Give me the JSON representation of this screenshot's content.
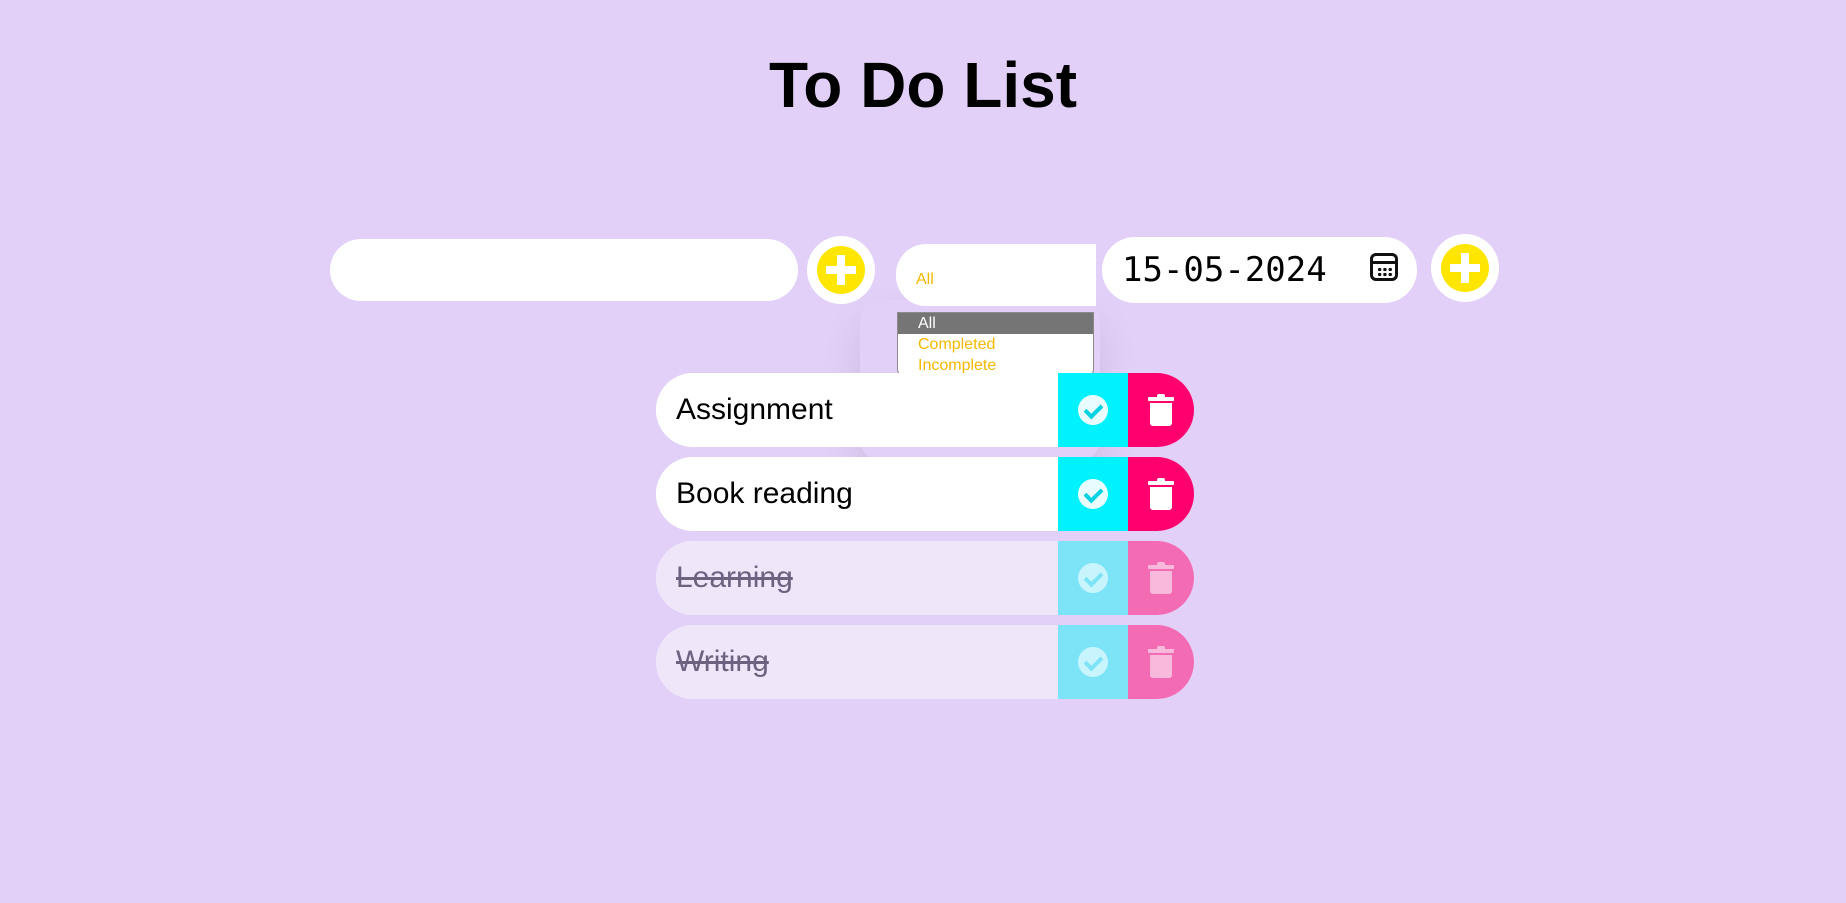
{
  "header": {
    "title": "To Do List"
  },
  "form": {
    "todo_input_value": "",
    "todo_input_placeholder": "",
    "filter_selected": "All",
    "filter_options": [
      "All",
      "Completed",
      "Incomplete"
    ],
    "date_value": "15-05-2024"
  },
  "todos": [
    {
      "label": "Assignment",
      "completed": false
    },
    {
      "label": "Book reading",
      "completed": false
    },
    {
      "label": "Learning",
      "completed": true
    },
    {
      "label": "Writing",
      "completed": true
    }
  ],
  "colors": {
    "background": "#e2d0f8",
    "add_button": "#ffe600",
    "check_button": "#00f2ff",
    "trash_button": "#ff006e",
    "filter_text": "#f5b800"
  },
  "icons": {
    "add": "plus-icon",
    "check": "check-circle-icon",
    "trash": "trash-icon",
    "calendar": "calendar-icon"
  }
}
